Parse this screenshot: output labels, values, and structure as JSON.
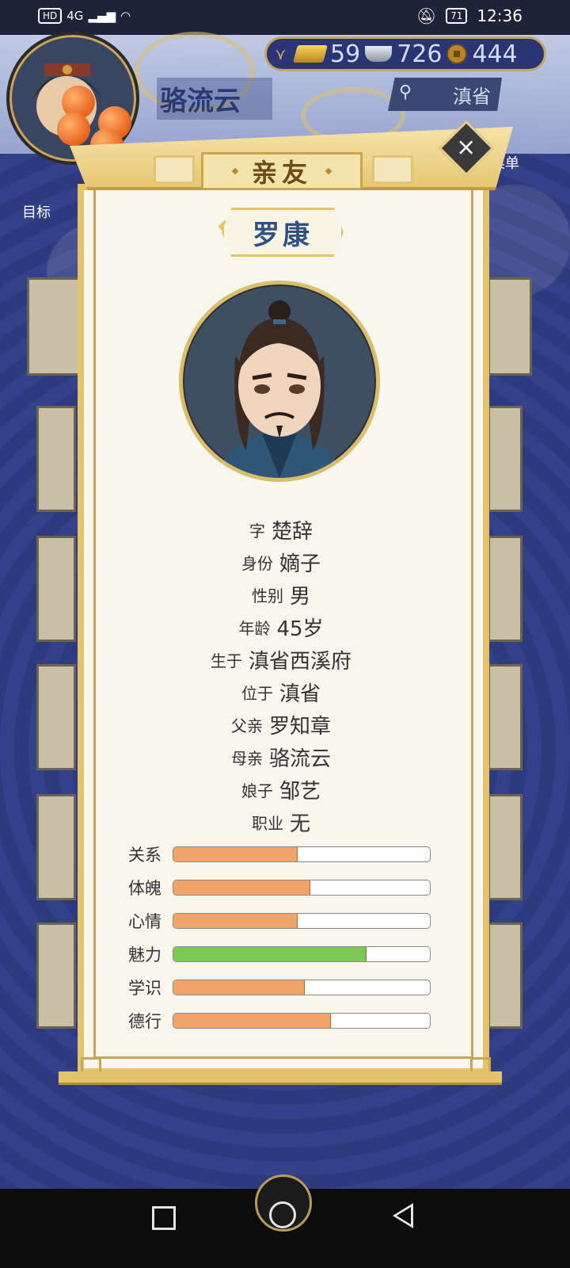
{
  "status_bar": {
    "hd": "HD",
    "network": "4G",
    "battery": "71",
    "time": "12:36"
  },
  "background": {
    "player_name": "骆流云",
    "resources": {
      "gold": "59",
      "silver": "726",
      "copper": "444"
    },
    "location_button": "滇省",
    "menu_label": "菜单",
    "goal_label": "目标"
  },
  "modal": {
    "title": "亲友",
    "close_icon": "close-x-icon",
    "character_name": "罗康",
    "info": [
      {
        "label": "字",
        "value": "楚辞"
      },
      {
        "label": "身份",
        "value": "嫡子"
      },
      {
        "label": "性别",
        "value": "男"
      },
      {
        "label": "年龄",
        "value": "45岁"
      },
      {
        "label": "生于",
        "value": "滇省西溪府"
      },
      {
        "label": "位于",
        "value": "滇省"
      },
      {
        "label": "父亲",
        "value": "罗知章"
      },
      {
        "label": "母亲",
        "value": "骆流云"
      },
      {
        "label": "娘子",
        "value": "邹艺"
      },
      {
        "label": "职业",
        "value": "无"
      }
    ],
    "stats": [
      {
        "label": "关系",
        "value": 0.48,
        "color": "#f0a46a"
      },
      {
        "label": "体魄",
        "value": 0.53,
        "color": "#f0a46a"
      },
      {
        "label": "心情",
        "value": 0.48,
        "color": "#f0a46a"
      },
      {
        "label": "魅力",
        "value": 0.75,
        "color": "#7cc95a"
      },
      {
        "label": "学识",
        "value": 0.51,
        "color": "#f0a46a"
      },
      {
        "label": "德行",
        "value": 0.61,
        "color": "#f0a46a"
      }
    ]
  },
  "nav_bar": {
    "icons": [
      "recent-apps-icon",
      "home-icon",
      "back-icon"
    ]
  }
}
